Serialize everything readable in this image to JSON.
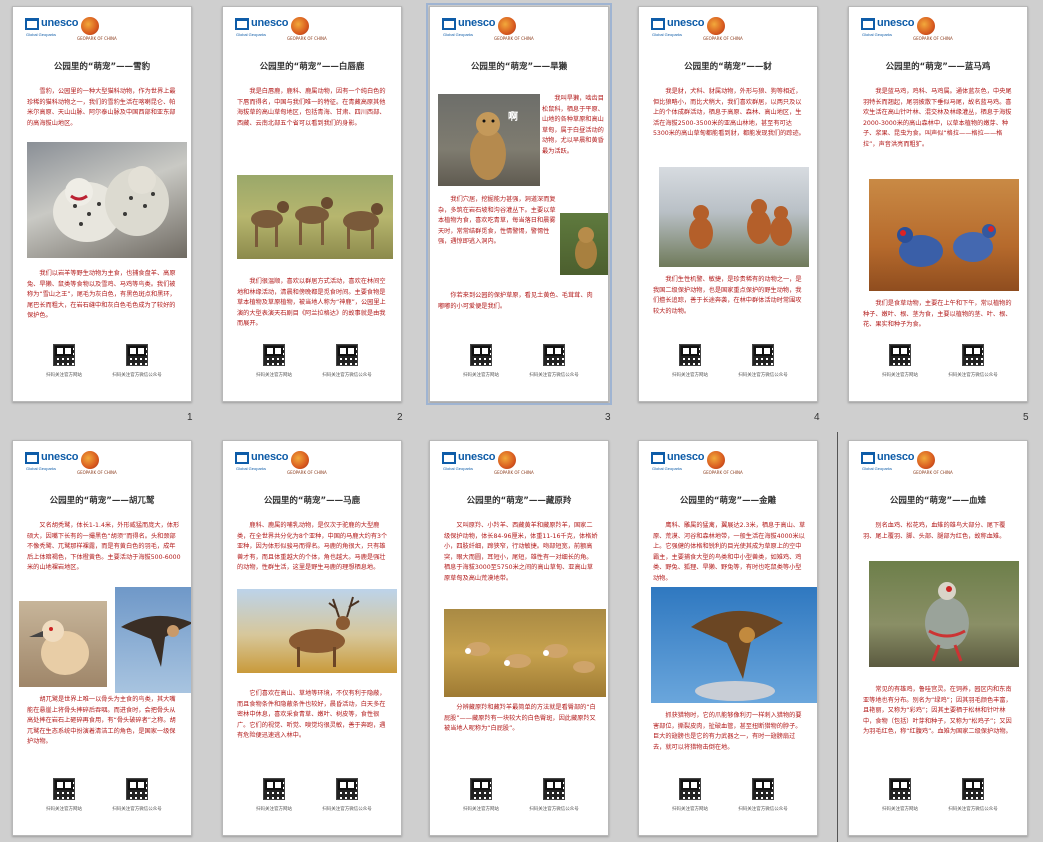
{
  "logos": {
    "unesco": "unesco",
    "unesco_sub": "Global Geoparks",
    "geopark_sub": "GEOPARK OF CHINA"
  },
  "qr_captions": [
    "扫码关注官方网站",
    "扫码关注官方微信公众号"
  ],
  "slides": [
    {
      "num": "1",
      "title": "公园里的“萌宠”——雪豹",
      "p1": "雪豹，公园里的一种大型猫科动物，作为世界上最珍稀的猫科动物之一，我们的雪豹生活在喀喇昆仑、帕米尔高原、天山山脉、阿尔泰山脉及中国西部和亚东部的高海拔山地区。",
      "p2": "我们以岩羊等野生动物为主食，也捕食盘羊、高原兔、旱獭、鼠类等食物以及雪鸡、马鸡等鸟类。我们被称为“雪山之王”，尾毛为灰白色，有黑色斑点和黑环，尾巴长而粗大，在岩石缝中和灰白色毛色成为了较好的保护色。"
    },
    {
      "num": "2",
      "title": "公园里的“萌宠”——白唇鹿",
      "p1": "我是白唇鹿，鹿科、鹿属动物，因有一个纯白色的下唇而得名，中国与我们唯一的特征。在青藏高原其他海拔草的高山草甸地区，包括青海、甘肃、四川西部、西藏、云南北部五个省可以看到我们的身影。",
      "p2": "我们很温顺，喜欢以群居方式活动，喜欢在林间空地和林缘活动，清晨和傍晚都是觅食时间。主要食物是草本植物及草原植物，被当地人称为“神鹿”，公园里上演的大型表演天石剧目《阿兰拉格达》的故事就是由我而展开。"
    },
    {
      "num": "3",
      "title": "公园里的“萌宠”——旱獭",
      "p1": "我叫旱獭，啮齿目松鼠科，栖息于平原、山地的各种草原和高山草甸，属于白昼活动的动物，尤以早晨和黄昏最为活跃。",
      "p2": "我们穴居，挖掘能力甚强，洞道深而复杂，多筑在岩石坡和沟谷灌丛下。主要以草本植物为食，喜欢吃青草，每当落日和晨雾天时，常常结群觅食，性情警惕，警惕性强，遇惊即逃入洞内。",
      "p3": "你若来到公园的保护草原，看见土黄色、毛茸茸、肉嘟嘟的小可爱便是我们。"
    },
    {
      "num": "4",
      "title": "公园里的“萌宠”——豺",
      "p1": "我是豺，犬科、豺属动物，外形与狼、狗等相近，但比狼略小，而比犬稍大，我们喜欢群居，以两只及以上的个体成群活动，栖息于高原、森林、高山地区，生活在海拔2500-3500米的亚高山林地，甚至有可达5300米的高山草甸都能看到豺，都能发现我们的踪迹。",
      "p2": "我们生性机警、敏捷，是珍贵稀有的动物之一，是我国二级保护动物，也是国家重点保护的野生动物，我们擅长追踪，善于长途奔袭，在林中群体活动时常围攻较大的动物。"
    },
    {
      "num": "5",
      "title": "公园里的“萌宠”——蓝马鸡",
      "p1": "我是蓝马鸡，鸡科、马鸡属。通体蓝灰色，中央尾羽特长而翘起，尾羽披散下垂似马尾，故名蓝马鸡。喜欢生活在高山针叶林、混交林及林缘灌丛，栖息于海拔2000-3000米的高山森林中，以草本植物的嫩芽、种子、浆果、昆虫为食。叫声似“格拉——格拉——格拉”，声音洪亮而粗犷。",
      "p2": "我们是食草动物，主要在上午和下午，常以植物的种子、嫩叶、根、茎为食，主要以植物的茎、叶、根、花、果实和种子为食。"
    },
    {
      "num": "",
      "title": "公园里的“萌宠”——胡兀鹫",
      "p1": "又名胡秃鹫，体长1-1.4米，外形威猛而庞大，体形硕大，因嘴下长有的一撮黑色“胡须”而得名。头和颈部不像秃鹫、兀鹫那样裸露，而是有黄白色的羽毛，成年后上体暗褐色，下体橙黄色。主要活动于海拔500-6000米的山地裸岩地区。",
      "p2": "胡兀鹫是世界上唯一以骨头为主食的鸟类，其大嘴能在悬崖上将骨头摔碎后吞咽。而进食时，会把骨头从高处摔在岩石上砸碎再食用，有“骨头破碎者”之称。胡兀鹫在生态系统中扮演着清洁工的角色，是国家一级保护动物。"
    },
    {
      "num": "",
      "title": "公园里的“萌宠”——马鹿",
      "p1": "鹿科、鹿属的哺乳动物，是仅次于驼鹿的大型鹿类，在全世界共分化为8个亚种，中国的马鹿大约有3个亚种，因为体形似骏马而得名。马鹿的角很大，只有雄兽才有，而且体重越大的个体，角也越大。马鹿是强壮的动物，性群生活，这里是野生马鹿的理想栖息地。",
      "p2": "它们喜欢在高山、草地等环境，不仅有利于隐蔽，而且食物条件和隐蔽条件也较好，晨昏活动，白天多在密林中休息，喜欢采食青草、嫩叶、树皮等，食性很广。它们的视觉、听觉、嗅觉均很灵敏，善于奔跑，遇有危险便迅速逃入林中。"
    },
    {
      "num": "",
      "title": "公园里的“萌宠”——藏原羚",
      "p1": "又叫原羚、小羚羊、西藏黄羊和藏原羚羊，国家二级保护动物，体长84-96厘米，体重11-16千克，体格娇小，四肢纤细，蹄狭窄，行动敏捷。吻部短宽，前额高突，眼大而圆，耳短小，尾短，雄性有一对细长的角。栖息于海拔3000至5750米之间的高山草甸、亚高山草原草甸及高山荒漠地带。",
      "p2": "分辨藏原羚和藏羚羊最简单的方法就是看臀部的“白屁股”——藏原羚有一块较大的白色臀斑，因此藏原羚又被当地人昵称为“白屁股”。"
    },
    {
      "num": "",
      "title": "公园里的“萌宠”——金雕",
      "p1": "鹰科、雕属的猛禽，翼展达2.3米，栖息于高山、草原、荒漠、河谷和森林地带，一般生活在海拔4000米以上。它强健的体格和锐利的目光使其成为草原上的空中霸主，主要捕食大型的鸟类和中小型兽类，如雉鸡、鸡类、野兔、狐狸、旱獭、野兔等，有时也吃鼠类等小型动物。",
      "p2": "抓获猎物时，它的爪能够像利刃一样刺入猎物的要害部位，撕裂皮肉，扯破血管，甚至扭断猎物的脖子。巨大的翅膀也是它的有力武器之一，有时一翅膀扇过去，就可以将猎物击倒在地。"
    },
    {
      "num": "",
      "title": "公园里的“萌宠”——血雉",
      "p1": "别名血鸡、松花鸡，血雉的雄鸟大部分、尾下覆羽、尾上覆羽、脚、头部、腿部为红色，故称血雉。",
      "p2": "常见的有雄鸡，鲁哇宫灵。在饲养，园区内和东南亚等地也有分布。别名为“绿鸡”；因其羽毛颜色丰富，且艳丽，又称为“彩鸡”；因其主要栖于松林和针叶林中，食物（包括）叶芽和种子，又称为“松鸡子”；又因为羽毛红色，称“红腹鸡”。血雉为国家二级保护动物。"
    }
  ]
}
